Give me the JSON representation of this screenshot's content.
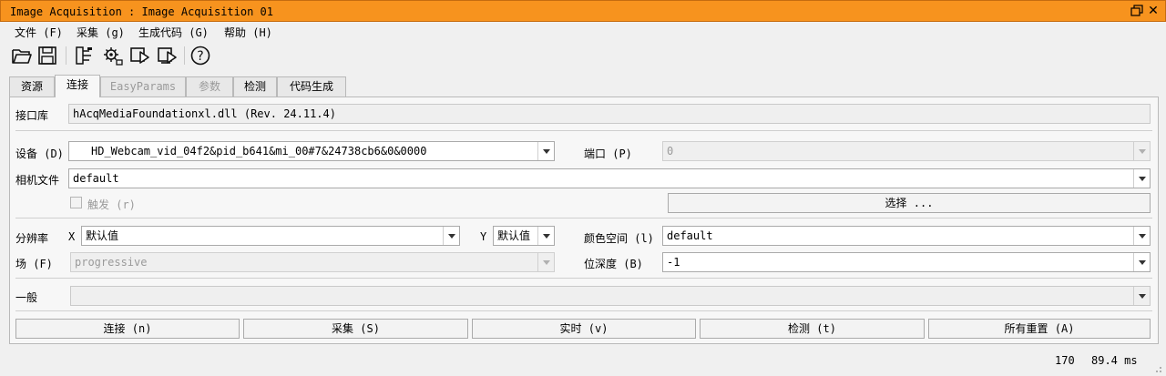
{
  "window": {
    "title": "Image Acquisition : Image Acquisition 01"
  },
  "menu": [
    "文件 (F)",
    "采集 (g)",
    "生成代码 (G)",
    "帮助 (H)"
  ],
  "toolbar": {
    "icons": [
      "folder-open-icon",
      "save-icon",
      "gripper-icon",
      "settings-icon",
      "snap-icon",
      "live-icon",
      "help-icon"
    ],
    "help_glyph": "?"
  },
  "tabs": [
    {
      "label": "资源",
      "state": "normal"
    },
    {
      "label": "连接",
      "state": "active"
    },
    {
      "label": "EasyParams",
      "state": "disabled"
    },
    {
      "label": "参数",
      "state": "disabled"
    },
    {
      "label": "检测",
      "state": "normal"
    },
    {
      "label": "代码生成",
      "state": "normal"
    }
  ],
  "connection": {
    "interface_label": "接口库",
    "interface_value": "hAcqMediaFoundationxl.dll (Rev. 24.11.4)",
    "device_label": "设备 (D)",
    "device_value": "HD_Webcam_vid_04f2&pid_b641&mi_00#7&24738cb6&0&0000",
    "port_label": "端口 (P)",
    "port_value": "0",
    "camera_file_label": "相机文件",
    "camera_file_value": "default",
    "trigger_label": "触发 (r)",
    "select_button": "选择 ...",
    "resolution_label": "分辨率",
    "res_x_label": "X",
    "res_x_value": "默认值",
    "res_y_label": "Y",
    "res_y_value": "默认值",
    "color_space_label": "颜色空间 (l)",
    "color_space_value": "default",
    "field_label": "场 (F)",
    "field_value": "progressive",
    "bit_depth_label": "位深度 (B)",
    "bit_depth_value": "-1",
    "general_label": "一般",
    "general_value": ""
  },
  "buttons": [
    "连接 (n)",
    "采集 (S)",
    "实时 (v)",
    "检测 (t)",
    "所有重置 (A)"
  ],
  "status": {
    "frame_count": "170",
    "frame_time": "89.4 ms"
  },
  "colors": {
    "title_bar": "#f7931e",
    "panel_bg": "#f7f7f7",
    "window_bg": "#f0f0f0"
  }
}
